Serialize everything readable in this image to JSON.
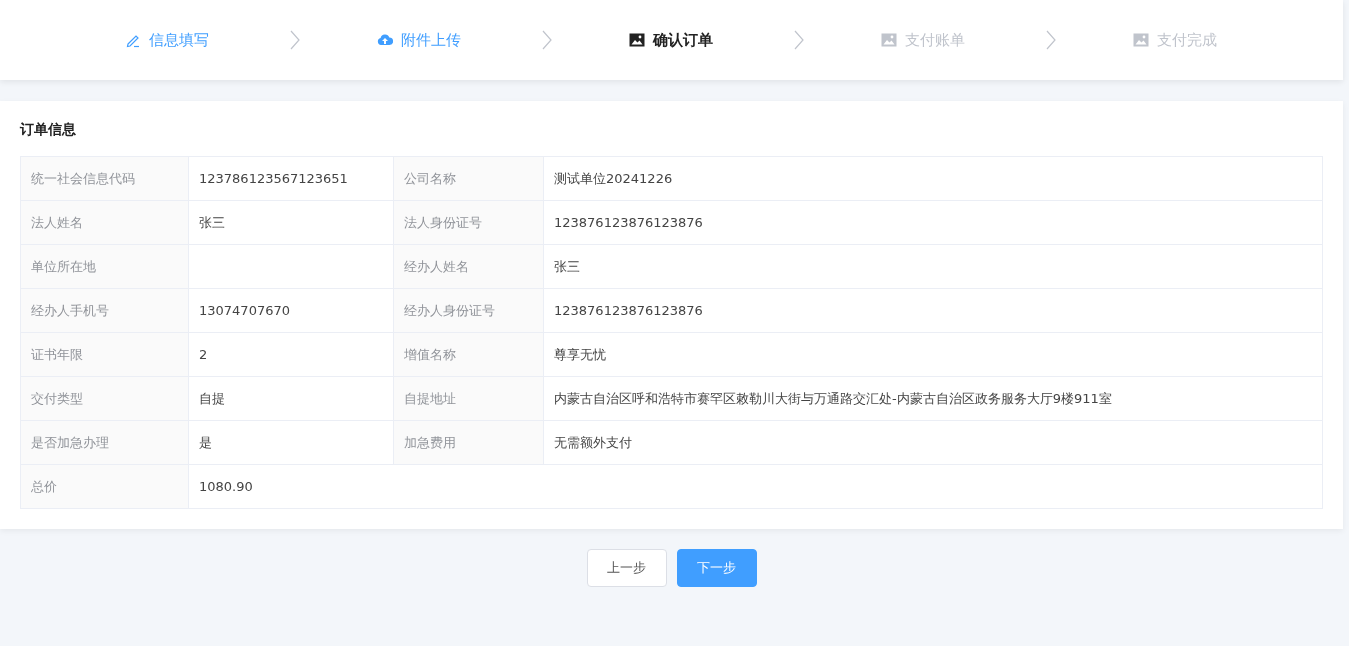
{
  "steps": [
    {
      "label": "信息填写",
      "kind": "pencil",
      "done": true,
      "selected": false
    },
    {
      "label": "附件上传",
      "kind": "upload",
      "done": true,
      "selected": false
    },
    {
      "label": "确认订单",
      "kind": "image",
      "done": false,
      "selected": true
    },
    {
      "label": "支付账单",
      "kind": "image",
      "done": false,
      "selected": false
    },
    {
      "label": "支付完成",
      "kind": "image",
      "done": false,
      "selected": false
    }
  ],
  "order": {
    "title": "订单信息",
    "rows": [
      [
        {
          "label": "统一社会信息代码",
          "value": "123786123567123651"
        },
        {
          "label": "公司名称",
          "value": "测试单位20241226"
        }
      ],
      [
        {
          "label": "法人姓名",
          "value": "张三"
        },
        {
          "label": "法人身份证号",
          "value": "123876123876123876"
        }
      ],
      [
        {
          "label": "单位所在地"
        },
        {
          "label": "经办人姓名",
          "value": "张三"
        }
      ],
      [
        {
          "label": "经办人手机号",
          "value": "13074707670"
        },
        {
          "label": "经办人身份证号",
          "value": "123876123876123876"
        }
      ],
      [
        {
          "label": "证书年限",
          "value": "2"
        },
        {
          "label": "增值名称",
          "value": "尊享无忧"
        }
      ],
      [
        {
          "label": "交付类型",
          "value": "自提"
        },
        {
          "label": "自提地址",
          "value": "内蒙古自治区呼和浩特市赛罕区敕勒川大街与万通路交汇处-内蒙古自治区政务服务大厅9楼911室"
        }
      ],
      [
        {
          "label": "是否加急办理",
          "value": "是"
        },
        {
          "label": "加急费用",
          "value": "无需额外支付"
        }
      ],
      [
        {
          "label": "总价",
          "value": "1080.90"
        }
      ]
    ]
  },
  "buttons": [
    {
      "label": "上一步",
      "kind": "secondary"
    },
    {
      "label": "下一步",
      "kind": "primary"
    }
  ]
}
